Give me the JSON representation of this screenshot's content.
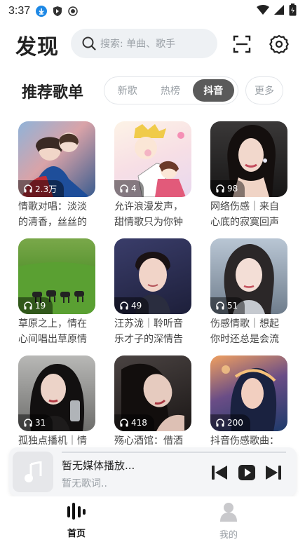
{
  "status_bar": {
    "time": "3:37"
  },
  "header": {
    "title": "发现",
    "search_placeholder": "搜索: 单曲、歌手"
  },
  "section": {
    "title": "推荐歌单",
    "tabs": [
      {
        "label": "新歌",
        "active": false
      },
      {
        "label": "热榜",
        "active": false
      },
      {
        "label": "抖音",
        "active": true
      }
    ],
    "more_label": "更多"
  },
  "playlists": [
    {
      "plays": "2.3万",
      "title": "情歌对唱：淡淡的清香，丝丝的"
    },
    {
      "plays": "4",
      "title": "允许浪漫发声，甜情歌只为你钟"
    },
    {
      "plays": "98",
      "title": "网络伤感｜来自心底的寂寞回声"
    },
    {
      "plays": "19",
      "title": "草原之上，情在心间唱出草原情"
    },
    {
      "plays": "49",
      "title": "汪苏泷｜聆听音乐才子的深情告"
    },
    {
      "plays": "51",
      "title": "伤感情歌｜想起你时还总是会流"
    },
    {
      "plays": "31",
      "title": "孤独点播机｜情"
    },
    {
      "plays": "418",
      "title": "殇心酒馆：借酒"
    },
    {
      "plays": "200",
      "title": "抖音伤感歌曲："
    }
  ],
  "player": {
    "title": "暂无媒体播放...",
    "lyric": "暂无歌词.."
  },
  "nav": {
    "home_label": "首页",
    "mine_label": "我的"
  },
  "colors": {
    "accent": "#5a5a5a",
    "search_bg": "#eef1f4",
    "muted": "#9aa0a6"
  }
}
